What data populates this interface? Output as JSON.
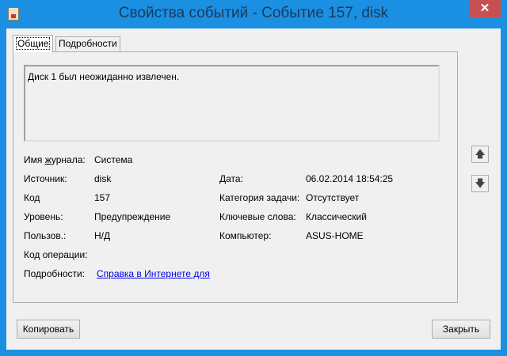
{
  "window": {
    "title": "Свойства событий - Событие 157, disk",
    "close_glyph": "✕"
  },
  "tabs": [
    {
      "label": "Общие"
    },
    {
      "label": "Подробности"
    }
  ],
  "description": "Диск 1 был неожиданно извлечен.",
  "fields": {
    "log_name": {
      "label": "Имя журнала:",
      "value": "Система"
    },
    "source": {
      "label": "Источник:",
      "value": "disk"
    },
    "event_id": {
      "label": "Код",
      "value": "157"
    },
    "level": {
      "label": "Уровень:",
      "value": "Предупреждение"
    },
    "user": {
      "label": "Пользов.:",
      "value": "Н/Д"
    },
    "opcode": {
      "label": "Код операции:",
      "value": ""
    },
    "more_info": {
      "label": "Подробности:",
      "link": "Справка в Интернете для"
    },
    "date": {
      "label": "Дата:",
      "value": "06.02.2014 18:54:25"
    },
    "task_category": {
      "label": "Категория задачи:",
      "value": "Отсутствует"
    },
    "keywords": {
      "label": "Ключевые слова:",
      "value": "Классический"
    },
    "computer": {
      "label": "Компьютер:",
      "value": "ASUS-HOME"
    }
  },
  "buttons": {
    "copy": "Копировать",
    "close": "Закрыть",
    "up": "🡅",
    "down": "🡇"
  }
}
